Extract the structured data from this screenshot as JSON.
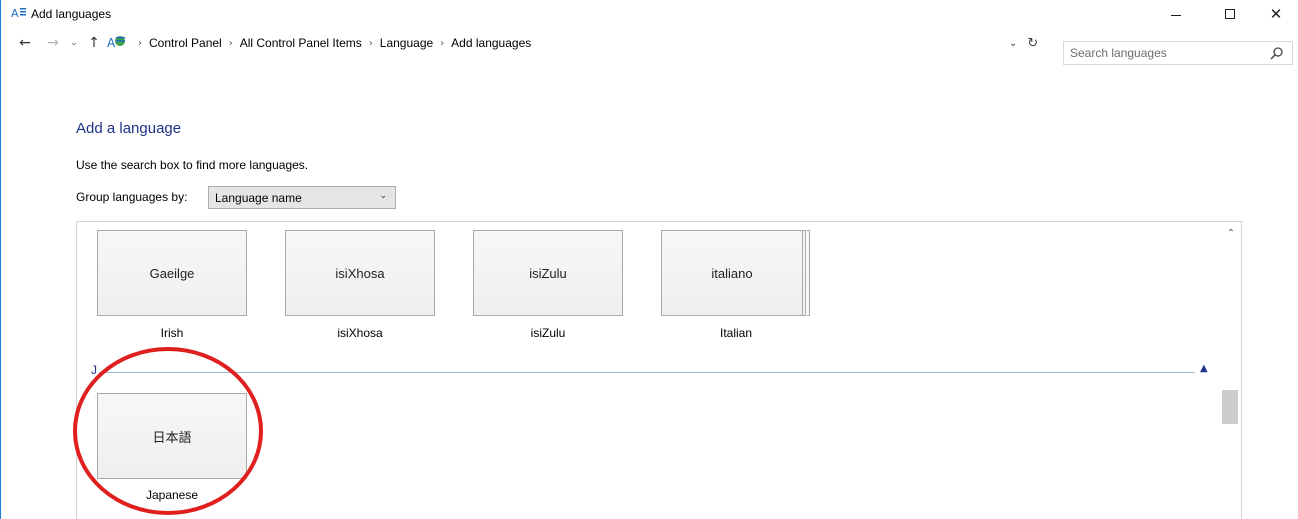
{
  "window": {
    "title": "Add languages",
    "controls": {
      "minimize": "minimize",
      "maximize": "maximize",
      "close": "close"
    }
  },
  "navigation": {
    "back_icon": "arrow-left-icon",
    "forward_icon": "arrow-right-icon",
    "recent_icon": "chevron-down-icon",
    "up_icon": "arrow-up-icon",
    "breadcrumb": [
      "Control Panel",
      "All Control Panel Items",
      "Language",
      "Add languages"
    ],
    "search_placeholder": "Search languages"
  },
  "content": {
    "heading": "Add a language",
    "hint": "Use the search box to find more languages.",
    "group_by_label": "Group languages by:",
    "group_by_value": "Language name",
    "tiles_row1": [
      {
        "native": "Gaeilge",
        "english": "Irish"
      },
      {
        "native": "isiXhosa",
        "english": "isiXhosa"
      },
      {
        "native": "isiZulu",
        "english": "isiZulu"
      },
      {
        "native": "italiano",
        "english": "Italian"
      }
    ],
    "section_letter": "J",
    "tiles_row2": [
      {
        "native": "日本語",
        "english": "Japanese"
      }
    ]
  },
  "colors": {
    "heading": "#1e3287",
    "highlight_ring": "#e0201f",
    "window_border": "#1a7ed6"
  }
}
